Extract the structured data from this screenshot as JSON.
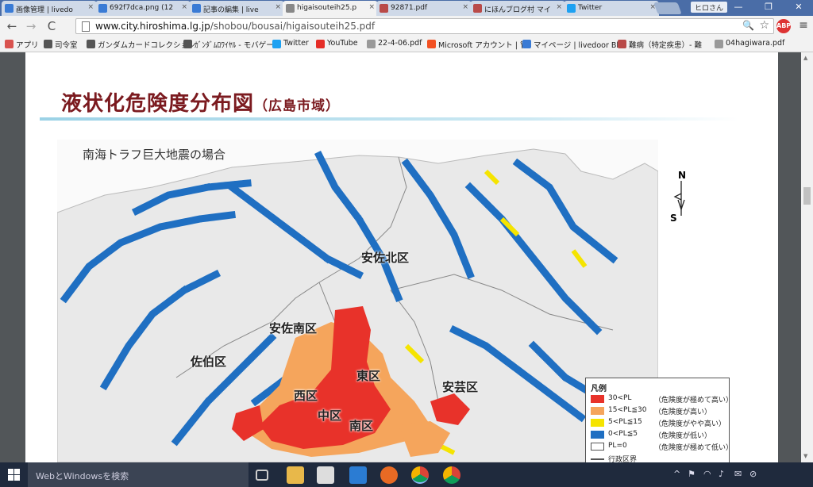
{
  "browser": {
    "tabs": [
      {
        "title": "画像管理 | livedo",
        "color": "#3a7bd5",
        "active": false
      },
      {
        "title": "692f7dca.png (12",
        "color": "#3a7bd5",
        "active": false
      },
      {
        "title": "記事の編集 | live",
        "color": "#3a7bd5",
        "active": false
      },
      {
        "title": "higaisouteih25.p",
        "color": "#888888",
        "active": true
      },
      {
        "title": "92871.pdf",
        "color": "#b94a48",
        "active": false
      },
      {
        "title": "にほんブログ村 マイ",
        "color": "#b94a48",
        "active": false
      },
      {
        "title": "Twitter",
        "color": "#1da1f2",
        "active": false
      }
    ],
    "profile_label": "ヒロさん",
    "window_controls": {
      "minimize": "—",
      "restore": "❐",
      "close": "✕"
    },
    "nav": {
      "back": "←",
      "forward": "→",
      "reload": "C"
    },
    "url": {
      "host": "www.city.hiroshima.lg.jp",
      "path": "/shobou/bousai/higaisouteih25.pdf"
    },
    "zoom_icon": "🔍",
    "star_icon": "☆",
    "extension_label": "ABP",
    "menu_icon": "≡",
    "bookmarks": [
      {
        "label": "アプリ",
        "icon": "apps-icon",
        "color": "#d9534f"
      },
      {
        "label": "司令室",
        "icon": "chrome-icon",
        "color": "#555555"
      },
      {
        "label": "ガンダムカードコレクション",
        "icon": "chrome-icon",
        "color": "#555555"
      },
      {
        "label": "ｶﾞﾝﾀﾞﾑﾛﾜｲﾔﾙ - モバゲー",
        "icon": "chrome-icon",
        "color": "#555555"
      },
      {
        "label": "Twitter",
        "icon": "twitter-icon",
        "color": "#1da1f2"
      },
      {
        "label": "YouTube",
        "icon": "youtube-icon",
        "color": "#e52d27"
      },
      {
        "label": "22-4-06.pdf",
        "icon": "doc-icon",
        "color": "#999999"
      },
      {
        "label": "Microsoft アカウント | 管",
        "icon": "microsoft-icon",
        "color": "#f25022"
      },
      {
        "label": "マイページ | livedoor Blo",
        "icon": "livedoor-icon",
        "color": "#3a7bd5"
      },
      {
        "label": "難病（特定疾患）- 難",
        "icon": "village-icon",
        "color": "#b94a48"
      },
      {
        "label": "04hagiwara.pdf",
        "icon": "doc-icon",
        "color": "#999999"
      }
    ]
  },
  "document": {
    "title": "液状化危険度分布図",
    "title_sub": "（広島市域）",
    "scenario": "南海トラフ巨大地震の場合",
    "compass": {
      "north": "N",
      "south": "S"
    },
    "wards": [
      {
        "name": "安佐北区"
      },
      {
        "name": "安佐南区"
      },
      {
        "name": "佐伯区"
      },
      {
        "name": "東区"
      },
      {
        "name": "西区"
      },
      {
        "name": "中区"
      },
      {
        "name": "南区"
      },
      {
        "name": "安芸区"
      }
    ],
    "legend": {
      "title": "凡例",
      "items": [
        {
          "label": "30<PL",
          "desc": "（危険度が極めて高い）",
          "color": "#e8322a"
        },
        {
          "label": "15<PL≦30",
          "desc": "（危険度が高い）",
          "color": "#f5a55c"
        },
        {
          "label": "5<PL≦15",
          "desc": "（危険度がやや高い）",
          "color": "#f5e400"
        },
        {
          "label": "0<PL≦5",
          "desc": "（危険度が低い）",
          "color": "#1f6fc2"
        },
        {
          "label": "PL=0",
          "desc": "（危険度が極めて低い）",
          "color": "#ffffff"
        },
        {
          "label": "行政区界",
          "desc": "",
          "color": "#ffffff"
        }
      ]
    }
  },
  "taskbar": {
    "search_placeholder": "WebとWindowsを検索",
    "tray_icons": [
      "^",
      "⚑",
      "◠",
      "♪",
      "✉",
      "⊘"
    ]
  }
}
